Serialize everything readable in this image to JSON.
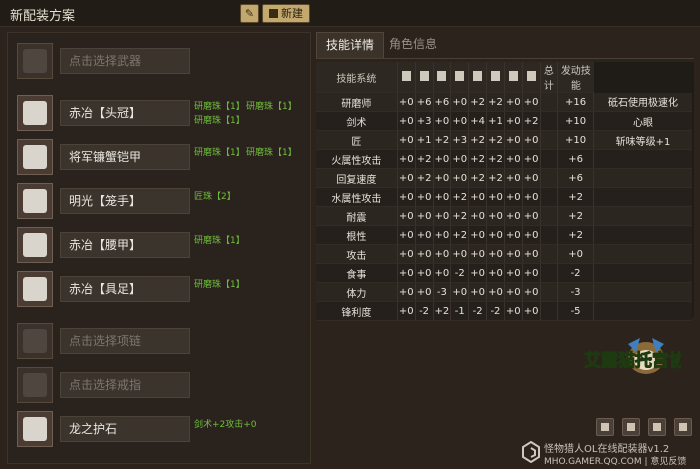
{
  "header": {
    "title": "新配装方案",
    "new_label": "新建",
    "edit_icon": "pencil-icon",
    "new_icon": "document-icon"
  },
  "equipment": [
    {
      "slot": "weapon",
      "name": "点击选择武器",
      "empty": true,
      "icon": "weapon-icon",
      "jewels": []
    },
    {
      "slot": "head",
      "name": "赤冶【头冠】",
      "empty": false,
      "icon": "helmet-icon",
      "jewels": [
        "研磨珠【1】",
        "研磨珠【1】",
        "研磨珠【1】"
      ]
    },
    {
      "slot": "chest",
      "name": "将军镰蟹铠甲",
      "empty": false,
      "icon": "chest-armor-icon",
      "jewels": [
        "研磨珠【1】",
        "研磨珠【1】"
      ]
    },
    {
      "slot": "arms",
      "name": "明光【笼手】",
      "empty": false,
      "icon": "gauntlet-icon",
      "jewels": [
        "匠珠【2】"
      ]
    },
    {
      "slot": "waist",
      "name": "赤冶【腰甲】",
      "empty": false,
      "icon": "waist-armor-icon",
      "jewels": [
        "研磨珠【1】"
      ]
    },
    {
      "slot": "legs",
      "name": "赤冶【具足】",
      "empty": false,
      "icon": "boots-icon",
      "jewels": [
        "研磨珠【1】"
      ]
    },
    {
      "slot": "necklace",
      "name": "点击选择项链",
      "empty": true,
      "icon": "necklace-icon",
      "jewels": []
    },
    {
      "slot": "ring",
      "name": "点击选择戒指",
      "empty": true,
      "icon": "ring-icon",
      "jewels": []
    },
    {
      "slot": "talisman",
      "name": "龙之护石",
      "empty": false,
      "icon": "talisman-icon",
      "jewels": [
        "剑术+2攻击+0"
      ]
    }
  ],
  "tabs": [
    {
      "label": "技能详情",
      "active": true
    },
    {
      "label": "角色信息",
      "active": false
    }
  ],
  "skills_table": {
    "col_skill": "技能系统",
    "col_total": "总计",
    "col_active": "发动技能",
    "part_icons": [
      "weapon-icon",
      "helmet-icon",
      "chest-armor-icon",
      "gauntlet-icon",
      "waist-armor-icon",
      "boots-icon",
      "necklace-icon",
      "ring-icon",
      "talisman-icon"
    ],
    "rows": [
      {
        "skill": "研磨师",
        "parts": [
          "+0",
          "+6",
          "+6",
          "+0",
          "+2",
          "+2",
          "+0",
          "+0"
        ],
        "total": "+16",
        "active": "砥石使用极速化"
      },
      {
        "skill": "剑术",
        "parts": [
          "+0",
          "+3",
          "+0",
          "+0",
          "+4",
          "+1",
          "+0",
          "+2"
        ],
        "total": "+10",
        "active": "心眼"
      },
      {
        "skill": "匠",
        "parts": [
          "+0",
          "+1",
          "+2",
          "+3",
          "+2",
          "+2",
          "+0",
          "+0"
        ],
        "total": "+10",
        "active": "斩味等级+1"
      },
      {
        "skill": "火属性攻击",
        "parts": [
          "+0",
          "+2",
          "+0",
          "+0",
          "+2",
          "+2",
          "+0",
          "+0"
        ],
        "total": "+6",
        "active": ""
      },
      {
        "skill": "回复速度",
        "parts": [
          "+0",
          "+2",
          "+0",
          "+0",
          "+2",
          "+2",
          "+0",
          "+0"
        ],
        "total": "+6",
        "active": ""
      },
      {
        "skill": "水属性攻击",
        "parts": [
          "+0",
          "+0",
          "+0",
          "+2",
          "+0",
          "+0",
          "+0",
          "+0"
        ],
        "total": "+2",
        "active": ""
      },
      {
        "skill": "耐震",
        "parts": [
          "+0",
          "+0",
          "+0",
          "+2",
          "+0",
          "+0",
          "+0",
          "+0"
        ],
        "total": "+2",
        "active": ""
      },
      {
        "skill": "根性",
        "parts": [
          "+0",
          "+0",
          "+0",
          "+2",
          "+0",
          "+0",
          "+0",
          "+0"
        ],
        "total": "+2",
        "active": ""
      },
      {
        "skill": "攻击",
        "parts": [
          "+0",
          "+0",
          "+0",
          "+0",
          "+0",
          "+0",
          "+0",
          "+0"
        ],
        "total": "+0",
        "active": ""
      },
      {
        "skill": "食事",
        "parts": [
          "+0",
          "+0",
          "+0",
          "-2",
          "+0",
          "+0",
          "+0",
          "+0"
        ],
        "total": "-2",
        "active": ""
      },
      {
        "skill": "体力",
        "parts": [
          "+0",
          "+0",
          "-3",
          "+0",
          "+0",
          "+0",
          "+0",
          "+0"
        ],
        "total": "-3",
        "active": ""
      },
      {
        "skill": "锋利度",
        "parts": [
          "+0",
          "-2",
          "+2",
          "-1",
          "-2",
          "-2",
          "+0",
          "+0"
        ],
        "total": "-5",
        "active": ""
      }
    ]
  },
  "toolbar_icons": [
    "save-icon",
    "refresh-icon",
    "delete-icon",
    "share-icon"
  ],
  "footer": {
    "line1": "怪物猎人OL在线配装器v1.2",
    "line2": "MHO.GAMER.QQ.COM | 意见反馈",
    "brand_icon": "gamer-logo-icon"
  },
  "logo": {
    "text": "艾露猫托宫协会",
    "icon": "felyne-guild-logo"
  },
  "colors": {
    "jewel_text": "#6fbf3a",
    "accent_button": "#c4a96f",
    "background": "#2b231c"
  }
}
